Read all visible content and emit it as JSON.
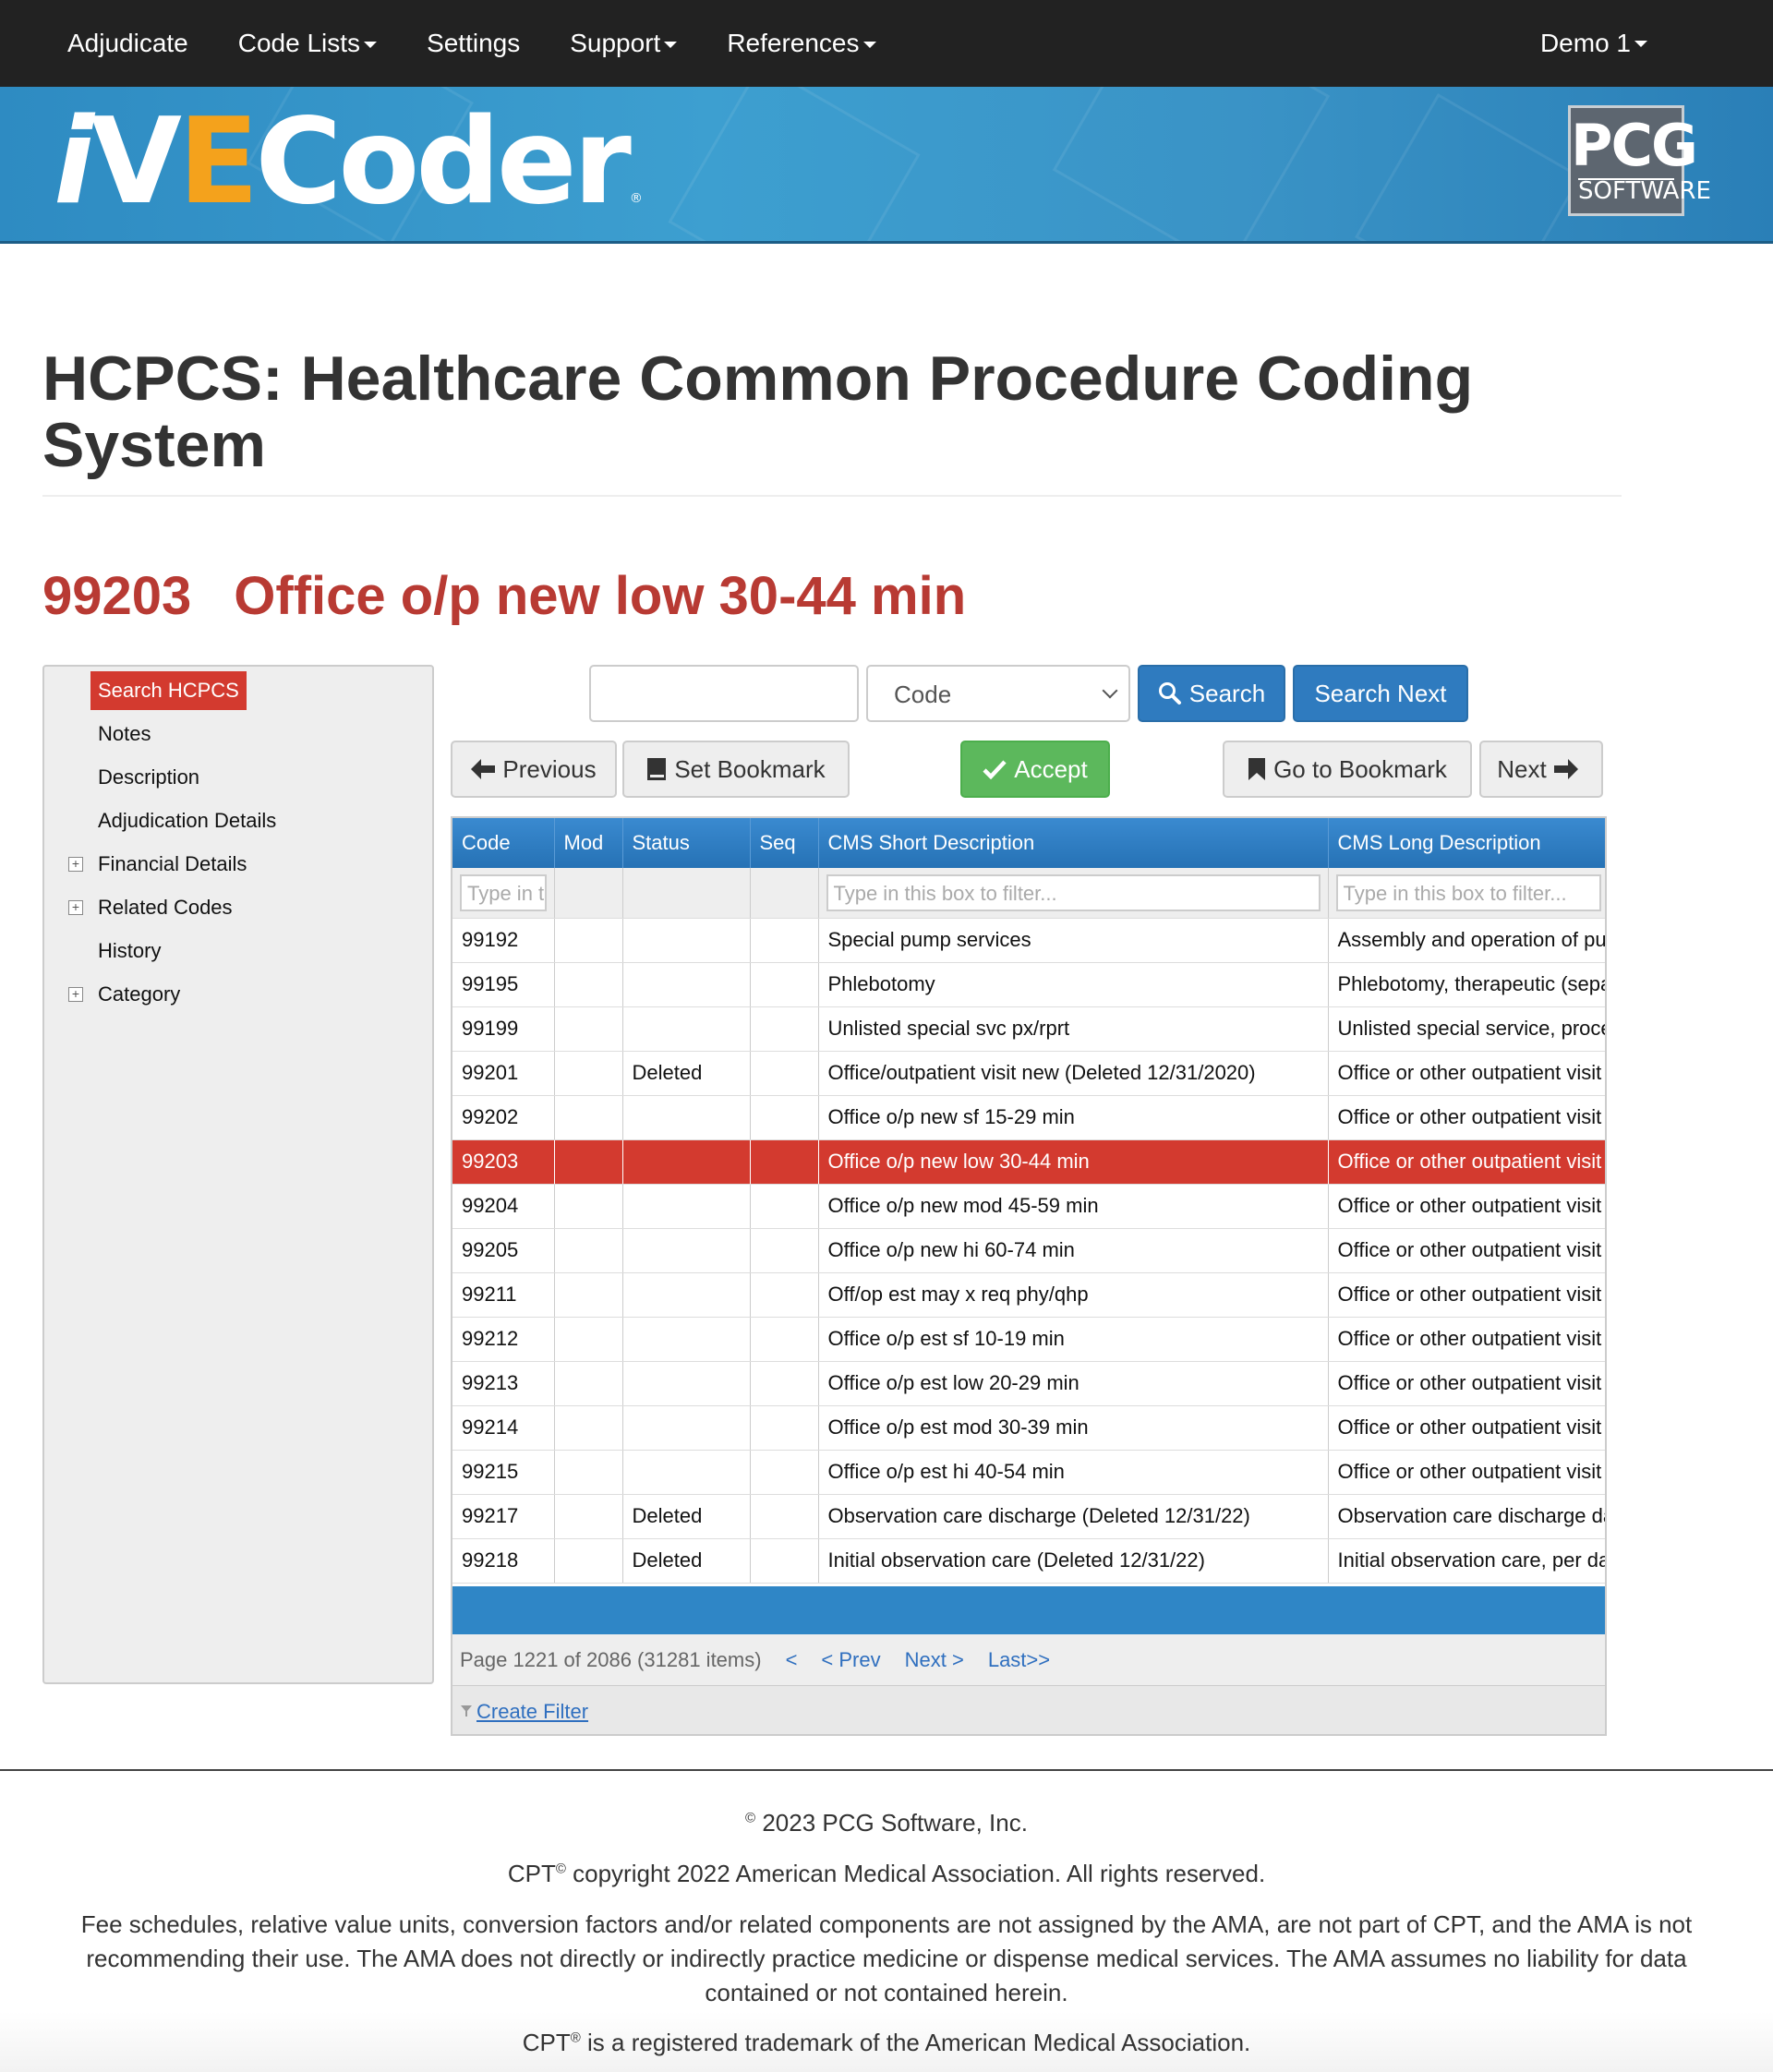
{
  "nav": {
    "items": [
      {
        "label": "Adjudicate",
        "dropdown": false
      },
      {
        "label": "Code Lists",
        "dropdown": true
      },
      {
        "label": "Settings",
        "dropdown": false
      },
      {
        "label": "Support",
        "dropdown": true
      },
      {
        "label": "References",
        "dropdown": true
      }
    ],
    "user": "Demo 1"
  },
  "banner": {
    "logo_i": "i",
    "logo_v": "V",
    "logo_e": "E",
    "logo_rest": "Coder",
    "logo_reg": "®",
    "pcg_big": "PCG",
    "pcg_small": "SOFTWARE"
  },
  "page": {
    "title": "HCPCS: Healthcare Common Procedure Coding System",
    "code": "99203",
    "code_desc": "Office o/p new low 30-44 min"
  },
  "sidebar": {
    "items": [
      {
        "label": "Search HCPCS",
        "active": true,
        "expandable": false
      },
      {
        "label": "Notes",
        "active": false,
        "expandable": false
      },
      {
        "label": "Description",
        "active": false,
        "expandable": false
      },
      {
        "label": "Adjudication Details",
        "active": false,
        "expandable": false
      },
      {
        "label": "Financial Details",
        "active": false,
        "expandable": true
      },
      {
        "label": "Related Codes",
        "active": false,
        "expandable": true
      },
      {
        "label": "History",
        "active": false,
        "expandable": false
      },
      {
        "label": "Category",
        "active": false,
        "expandable": true
      }
    ]
  },
  "search": {
    "input_value": "",
    "select_value": "Code",
    "search_label": "Search",
    "search_next_label": "Search Next"
  },
  "actions": {
    "previous": "Previous",
    "set_bookmark": "Set Bookmark",
    "accept": "Accept",
    "go_to_bookmark": "Go to Bookmark",
    "next": "Next"
  },
  "grid": {
    "columns": [
      "Code",
      "Mod",
      "Status",
      "Seq",
      "CMS Short Description",
      "CMS Long Description"
    ],
    "filters": {
      "code": "Type in t",
      "short": "Type in this box to filter...",
      "long": "Type in this box to filter..."
    },
    "rows": [
      {
        "code": "99192",
        "mod": "",
        "status": "",
        "seq": "",
        "short": "Special pump services",
        "long": "Assembly and operation of pu",
        "selected": false
      },
      {
        "code": "99195",
        "mod": "",
        "status": "",
        "seq": "",
        "short": "Phlebotomy",
        "long": "Phlebotomy, therapeutic (sepa",
        "selected": false
      },
      {
        "code": "99199",
        "mod": "",
        "status": "",
        "seq": "",
        "short": "Unlisted special svc px/rprt",
        "long": "Unlisted special service, proce",
        "selected": false
      },
      {
        "code": "99201",
        "mod": "",
        "status": "Deleted",
        "seq": "",
        "short": "Office/outpatient visit new (Deleted 12/31/2020)",
        "long": "Office or other outpatient visit",
        "selected": false
      },
      {
        "code": "99202",
        "mod": "",
        "status": "",
        "seq": "",
        "short": "Office o/p new sf 15-29 min",
        "long": "Office or other outpatient visit",
        "selected": false
      },
      {
        "code": "99203",
        "mod": "",
        "status": "",
        "seq": "",
        "short": "Office o/p new low 30-44 min",
        "long": "Office or other outpatient visit",
        "selected": true
      },
      {
        "code": "99204",
        "mod": "",
        "status": "",
        "seq": "",
        "short": "Office o/p new mod 45-59 min",
        "long": "Office or other outpatient visit",
        "selected": false
      },
      {
        "code": "99205",
        "mod": "",
        "status": "",
        "seq": "",
        "short": "Office o/p new hi 60-74 min",
        "long": "Office or other outpatient visit",
        "selected": false
      },
      {
        "code": "99211",
        "mod": "",
        "status": "",
        "seq": "",
        "short": "Off/op est may x req phy/qhp",
        "long": "Office or other outpatient visit",
        "selected": false
      },
      {
        "code": "99212",
        "mod": "",
        "status": "",
        "seq": "",
        "short": "Office o/p est sf 10-19 min",
        "long": "Office or other outpatient visit",
        "selected": false
      },
      {
        "code": "99213",
        "mod": "",
        "status": "",
        "seq": "",
        "short": "Office o/p est low 20-29 min",
        "long": "Office or other outpatient visit",
        "selected": false
      },
      {
        "code": "99214",
        "mod": "",
        "status": "",
        "seq": "",
        "short": "Office o/p est mod 30-39 min",
        "long": "Office or other outpatient visit",
        "selected": false
      },
      {
        "code": "99215",
        "mod": "",
        "status": "",
        "seq": "",
        "short": "Office o/p est hi 40-54 min",
        "long": "Office or other outpatient visit",
        "selected": false
      },
      {
        "code": "99217",
        "mod": "",
        "status": "Deleted",
        "seq": "",
        "short": "Observation care discharge (Deleted 12/31/22)",
        "long": "Observation care discharge da",
        "selected": false
      },
      {
        "code": "99218",
        "mod": "",
        "status": "Deleted",
        "seq": "",
        "short": "Initial observation care (Deleted 12/31/22)",
        "long": "Initial observation care, per da",
        "selected": false
      }
    ],
    "pager": {
      "summary": "Page 1221 of 2086 (31281 items)",
      "first": "<",
      "prev": "< Prev",
      "next": "Next >",
      "last": "Last>>"
    },
    "create_filter": "Create Filter"
  },
  "footer": {
    "copyright": "2023 PCG Software, Inc.",
    "copyright_symbol": "©",
    "cpt_line_pre": "CPT",
    "cpt_line_symbol": "©",
    "cpt_line_post": "copyright 2022 American Medical Association. All rights reserved.",
    "disclaimer": "Fee schedules, relative value units, conversion factors and/or related components are not assigned by the AMA, are not part of CPT, and the AMA is not recommending their use. The AMA does not directly or indirectly practice medicine or dispense medical services. The AMA assumes no liability for data contained or not contained herein.",
    "trademark_pre": "CPT",
    "trademark_symbol": "®",
    "trademark_post": "is a registered trademark of the American Medical Association."
  },
  "colors": {
    "nav_bg": "#222222",
    "banner_blue": "#3a93c6",
    "brand_orange": "#f4a21c",
    "heading_red": "#b83a33",
    "selected_red": "#d33a2f",
    "primary_blue": "#2f7bbf",
    "success_green": "#5cb85c"
  }
}
